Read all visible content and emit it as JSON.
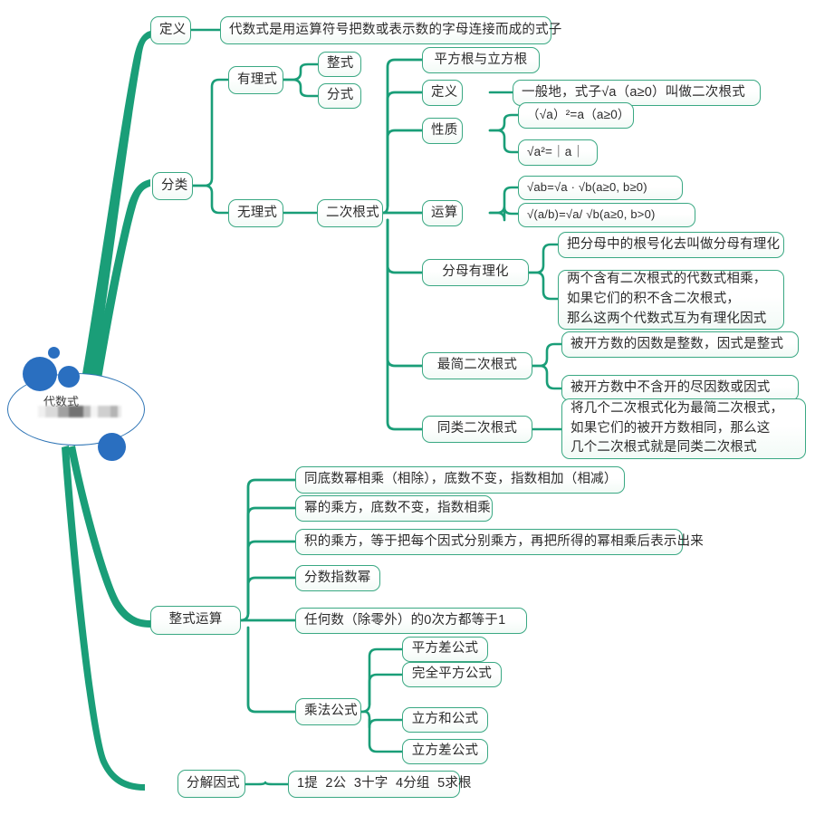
{
  "title": "代数式 思维导图",
  "colors": {
    "branch": "#1a9e78",
    "node_border": "#3aa883",
    "root_border": "#2e74b5",
    "root_dot": "#2a6fc0",
    "text": "#2b2b2b",
    "background": "#ffffff"
  },
  "root": {
    "label": "代数式",
    "redacted_label": "",
    "shape": "ellipse"
  },
  "nodes": {
    "dingyi": "定义",
    "dingyi_desc": "代数式是用运算符号把数或表示数的字母连接而成的式子",
    "fenlei": "分类",
    "youlishi": "有理式",
    "zhengshi": "整式",
    "fenshi": "分式",
    "wulishi": "无理式",
    "erci": "二次根式",
    "pingfang_ligfang": "平方根与立方根",
    "erci_dingyi": "定义",
    "erci_dingyi_desc": "一般地，式子√a（a≥0）叫做二次根式",
    "xingzhi": "性质",
    "xingzhi_1": "（√a）²=a（a≥0）",
    "xingzhi_2": "√a²=｜a｜",
    "yunsuan": "运算",
    "yunsuan_1": "√ab=√a · √b(a≥0, b≥0)",
    "yunsuan_2": "√(a/b)=√a/ √b(a≥0, b>0)",
    "fenmu": "分母有理化",
    "fenmu_1": "把分母中的根号化去叫做分母有理化",
    "fenmu_2": "两个含有二次根式的代数式相乘，\n如果它们的积不含二次根式，\n那么这两个代数式互为有理化因式",
    "zuijian": "最简二次根式",
    "zuijian_1": "被开方数的因数是整数，因式是整式",
    "zuijian_2": "被开方数中不含开的尽因数或因式",
    "tonglei": "同类二次根式",
    "tonglei_1": "将几个二次根式化为最简二次根式，\n如果它们的被开方数相同，那么这\n几个二次根式就是同类二次根式",
    "zhengshi_yunsuan": "整式运算",
    "zs_1": "同底数幂相乘（相除），底数不变，指数相加（相减）",
    "zs_2": "幂的乘方，底数不变，指数相乘",
    "zs_3": "积的乘方，等于把每个因式分别乘方，再把所得的幂相乘后表示出来",
    "zs_4": "分数指数幂",
    "zs_5": "任何数（除零外）的0次方都等于1",
    "chengfa": "乘法公式",
    "cf_1": "平方差公式",
    "cf_2": "完全平方公式",
    "cf_3": "立方和公式",
    "cf_4": "立方差公式",
    "fenjie": "分解因式",
    "fenjie_1": "1提  2公  3十字  4分组  5求根"
  }
}
